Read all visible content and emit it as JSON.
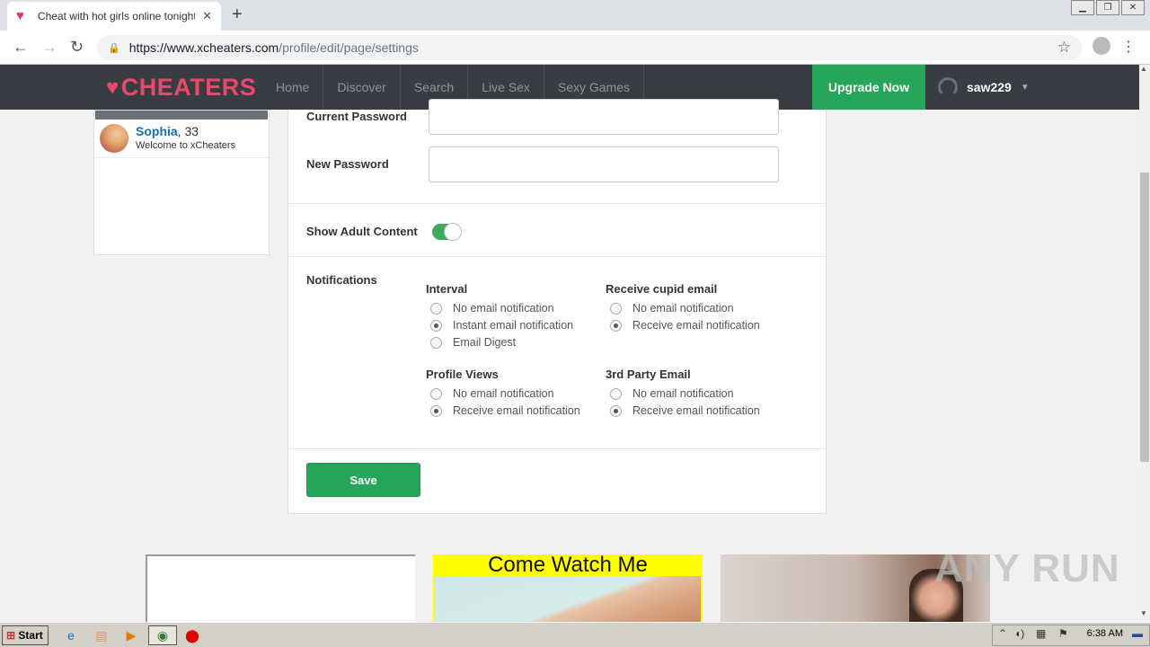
{
  "browser": {
    "tab_title": "Cheat with hot girls online tonight fo",
    "url_host": "https://www.xcheaters.com",
    "url_path": "/profile/edit/page/settings"
  },
  "site": {
    "logo": "CHEATERS",
    "nav": [
      "Home",
      "Discover",
      "Search",
      "Live Sex",
      "Sexy Games"
    ],
    "upgrade": "Upgrade Now",
    "username": "saw229"
  },
  "sidebar": {
    "name": "Sophia",
    "age": ", 33",
    "subtitle": "Welcome to xCheaters"
  },
  "settings": {
    "current_password_label": "Current Password",
    "new_password_label": "New Password",
    "adult_content_label": "Show Adult Content",
    "adult_content_on": true,
    "notifications_label": "Notifications",
    "groups": [
      {
        "title": "Interval",
        "options": [
          "No email notification",
          "Instant email notification",
          "Email Digest"
        ],
        "selected": 1
      },
      {
        "title": "Receive cupid email",
        "options": [
          "No email notification",
          "Receive email notification"
        ],
        "selected": 1
      },
      {
        "title": "Profile Views",
        "options": [
          "No email notification",
          "Receive email notification"
        ],
        "selected": 1
      },
      {
        "title": "3rd Party Email",
        "options": [
          "No email notification",
          "Receive email notification"
        ],
        "selected": 1
      }
    ],
    "save": "Save"
  },
  "ads": {
    "ad2_text": "Come Watch Me"
  },
  "watermark": "ANY RUN",
  "taskbar": {
    "start": "Start",
    "clock": "6:38 AM"
  },
  "colors": {
    "accent_green": "#26a65b",
    "logo_pink": "#e8486b",
    "header_dark": "#383d43"
  }
}
